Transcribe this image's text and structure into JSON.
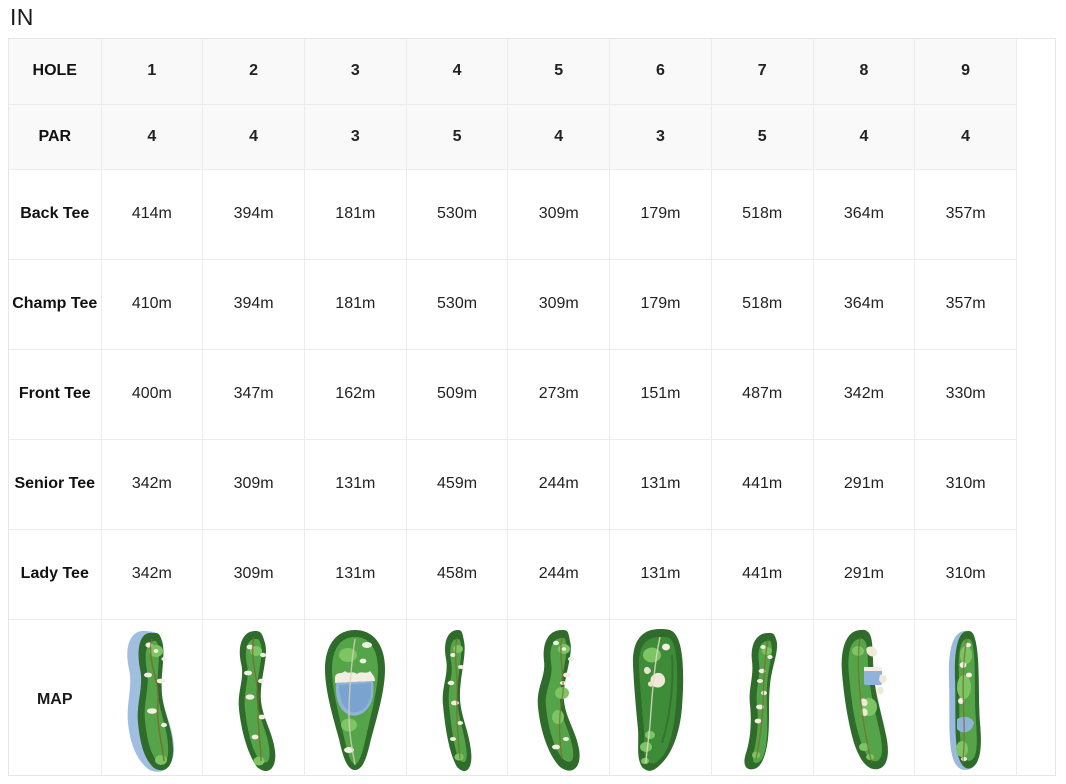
{
  "section": {
    "title": "IN"
  },
  "table": {
    "row_labels": {
      "hole": "HOLE",
      "par": "PAR",
      "back_tee": "Back Tee",
      "champ_tee": "Champ Tee",
      "front_tee": "Front Tee",
      "senior_tee": "Senior Tee",
      "lady_tee": "Lady Tee",
      "map": "MAP"
    },
    "holes": [
      "1",
      "2",
      "3",
      "4",
      "5",
      "6",
      "7",
      "8",
      "9"
    ],
    "par": [
      "4",
      "4",
      "3",
      "5",
      "4",
      "3",
      "5",
      "4",
      "4"
    ],
    "rows": [
      {
        "label": "Back Tee",
        "values": [
          "414m",
          "394m",
          "181m",
          "530m",
          "309m",
          "179m",
          "518m",
          "364m",
          "357m"
        ]
      },
      {
        "label": "Champ Tee",
        "values": [
          "410m",
          "394m",
          "181m",
          "530m",
          "309m",
          "179m",
          "518m",
          "364m",
          "357m"
        ]
      },
      {
        "label": "Front Tee",
        "values": [
          "400m",
          "347m",
          "162m",
          "509m",
          "273m",
          "151m",
          "487m",
          "342m",
          "330m"
        ]
      },
      {
        "label": "Senior Tee",
        "values": [
          "342m",
          "309m",
          "131m",
          "459m",
          "244m",
          "131m",
          "441m",
          "291m",
          "310m"
        ]
      },
      {
        "label": "Lady Tee",
        "values": [
          "342m",
          "309m",
          "131m",
          "458m",
          "244m",
          "131m",
          "441m",
          "291m",
          "310m"
        ]
      }
    ],
    "maps": [
      {
        "hole": "1",
        "icon": "hole-map-icon-1",
        "shape": "dogleg-water-left",
        "has_water": true
      },
      {
        "hole": "2",
        "icon": "hole-map-icon-2",
        "shape": "s-curve",
        "has_water": false
      },
      {
        "hole": "3",
        "icon": "hole-map-icon-3",
        "shape": "wide-pond",
        "has_water": true
      },
      {
        "hole": "4",
        "icon": "hole-map-icon-4",
        "shape": "narrow-s",
        "has_water": false
      },
      {
        "hole": "5",
        "icon": "hole-map-icon-5",
        "shape": "s-curve-wide",
        "has_water": false
      },
      {
        "hole": "6",
        "icon": "hole-map-icon-6",
        "shape": "broad-pear",
        "has_water": false
      },
      {
        "hole": "7",
        "icon": "hole-map-icon-7",
        "shape": "hook",
        "has_water": false
      },
      {
        "hole": "8",
        "icon": "hole-map-icon-8",
        "shape": "crescent-pond",
        "has_water": true
      },
      {
        "hole": "9",
        "icon": "hole-map-icon-9",
        "shape": "straight-water-left",
        "has_water": true
      }
    ]
  },
  "colors": {
    "rough": "#2f6b2b",
    "rough_dark": "#1f4d1c",
    "fairway": "#56a449",
    "green": "#7cc464",
    "bunker": "#f2efe2",
    "water": "#8fb3d9",
    "water_deep": "#7aa3cf",
    "border": "#ececec",
    "header_bg": "#f9f9f9",
    "text": "#1a1a1a"
  }
}
